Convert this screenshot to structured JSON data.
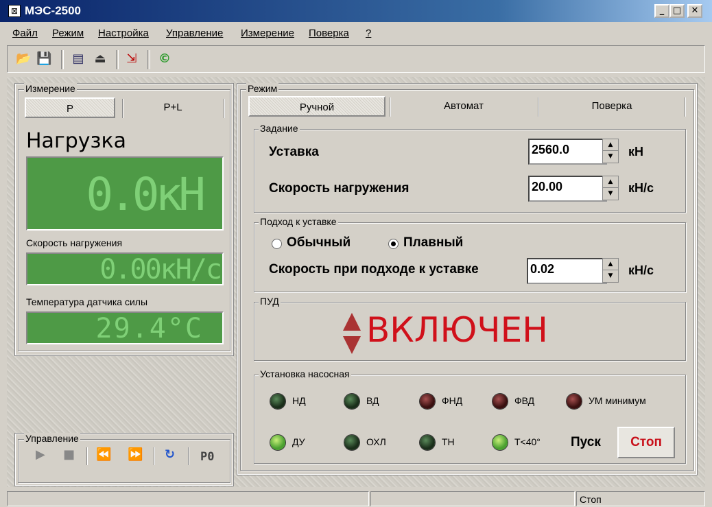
{
  "window": {
    "title": "МЭС-2500",
    "min": "_",
    "max": "□",
    "close": "✕"
  },
  "menu": [
    "Файл",
    "Режим",
    "Настройка",
    "Управление",
    "Измерение",
    "Поверка",
    "?"
  ],
  "measurement": {
    "group_label": "Измерение",
    "tabs": [
      "P",
      "P+L"
    ],
    "load_label": "Нагрузка",
    "load_value": "0.0кН",
    "rate_label": "Скорость нагружения",
    "rate_value": "0.00кН/с",
    "temp_label": "Температура датчика силы",
    "temp_value": "29.4°C"
  },
  "control": {
    "group_label": "Управление",
    "po_label": "P0"
  },
  "mode": {
    "group_label": "Режим",
    "tabs": [
      "Ручной",
      "Автомат",
      "Поверка"
    ],
    "task": {
      "group_label": "Задание",
      "setpoint_label": "Уставка",
      "setpoint_value": "2560.0",
      "setpoint_unit": "кН",
      "rate_label": "Скорость нагружения",
      "rate_value": "20.00",
      "rate_unit": "кН/с"
    },
    "approach": {
      "group_label": "Подход к уставке",
      "opt_normal": "Обычный",
      "opt_smooth": "Плавный",
      "selected": "Плавный",
      "speed_label": "Скорость при подходе к уставке",
      "speed_value": "0.02",
      "speed_unit": "кН/с"
    },
    "pud": {
      "group_label": "ПУД",
      "state": "ВКЛЮЧЕН",
      "state_color": "#d0101a"
    },
    "pump": {
      "group_label": "Установка насосная",
      "leds": [
        {
          "label": "НД",
          "state": "dark"
        },
        {
          "label": "ВД",
          "state": "dark"
        },
        {
          "label": "ФНД",
          "state": "red"
        },
        {
          "label": "ФВД",
          "state": "red"
        },
        {
          "label": "УМ минимум",
          "state": "red"
        },
        {
          "label": "ДУ",
          "state": "on"
        },
        {
          "label": "ОХЛ",
          "state": "dark"
        },
        {
          "label": "ТН",
          "state": "dark"
        },
        {
          "label": "Т<40°",
          "state": "on"
        }
      ],
      "start_label": "Пуск",
      "stop_label": "Стоп"
    }
  },
  "status": {
    "right": "Стоп"
  }
}
